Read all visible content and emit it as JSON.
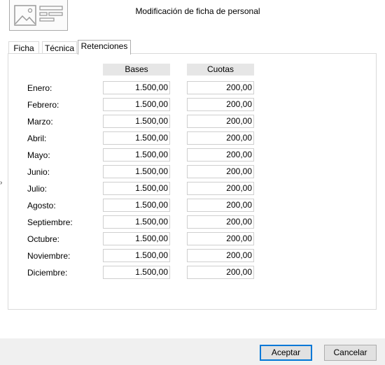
{
  "window": {
    "title": "Modificación de ficha de personal"
  },
  "tabs": [
    {
      "label": "Ficha"
    },
    {
      "label": "Técnica"
    },
    {
      "label": "Retenciones"
    }
  ],
  "active_tab": "Retenciones",
  "table": {
    "columns": [
      "Bases",
      "Cuotas"
    ],
    "rows": [
      {
        "month": "Enero:",
        "base": "1.500,00",
        "cuota": "200,00"
      },
      {
        "month": "Febrero:",
        "base": "1.500,00",
        "cuota": "200,00"
      },
      {
        "month": "Marzo:",
        "base": "1.500,00",
        "cuota": "200,00"
      },
      {
        "month": "Abril:",
        "base": "1.500,00",
        "cuota": "200,00"
      },
      {
        "month": "Mayo:",
        "base": "1.500,00",
        "cuota": "200,00"
      },
      {
        "month": "Junio:",
        "base": "1.500,00",
        "cuota": "200,00"
      },
      {
        "month": "Julio:",
        "base": "1.500,00",
        "cuota": "200,00"
      },
      {
        "month": "Agosto:",
        "base": "1.500,00",
        "cuota": "200,00"
      },
      {
        "month": "Septiembre:",
        "base": "1.500,00",
        "cuota": "200,00"
      },
      {
        "month": "Octubre:",
        "base": "1.500,00",
        "cuota": "200,00"
      },
      {
        "month": "Noviembre:",
        "base": "1.500,00",
        "cuota": "200,00"
      },
      {
        "month": "Diciembre:",
        "base": "1.500,00",
        "cuota": "200,00"
      }
    ]
  },
  "buttons": {
    "accept": "Aceptar",
    "cancel": "Cancelar"
  },
  "icons": {
    "app": "image-card-icon",
    "side": "chevron-right-icon"
  },
  "colors": {
    "default_button_border": "#0078d7",
    "footer_bg": "#f0f0f0",
    "header_bg": "#e6e6e6"
  }
}
